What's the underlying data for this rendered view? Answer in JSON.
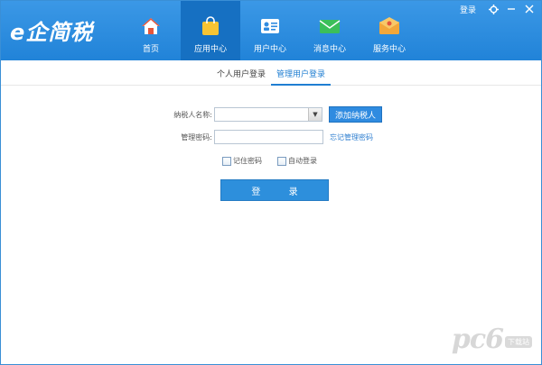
{
  "app": {
    "logo_text": "e企简税"
  },
  "window_controls": {
    "login_label": "登录",
    "settings_icon": "gear-icon",
    "minimize_icon": "minimize-icon",
    "close_icon": "close-icon"
  },
  "nav": {
    "items": [
      {
        "label": "首页",
        "icon": "home-icon"
      },
      {
        "label": "应用中心",
        "icon": "app-bag-icon"
      },
      {
        "label": "用户中心",
        "icon": "user-card-icon"
      },
      {
        "label": "消息中心",
        "icon": "message-envelope-icon"
      },
      {
        "label": "服务中心",
        "icon": "service-envelope-icon"
      }
    ],
    "active_index": 1
  },
  "tabs": [
    {
      "label": "个人用户登录"
    },
    {
      "label": "管理用户登录"
    }
  ],
  "active_tab": 1,
  "form": {
    "taxpayer_label": "纳税人名称:",
    "taxpayer_value": "",
    "add_taxpayer_label": "添加纳税人",
    "password_label": "管理密码:",
    "password_value": "",
    "forgot_password_label": "忘记管理密码",
    "remember_password_label": "记住密码",
    "auto_login_label": "自动登录",
    "login_button_label": "登 录"
  },
  "watermark": {
    "text": "pc6",
    "badge": "下载站"
  },
  "colors": {
    "header_blue": "#2386da",
    "active_nav": "#1670c2",
    "accent": "#2f8be0"
  }
}
